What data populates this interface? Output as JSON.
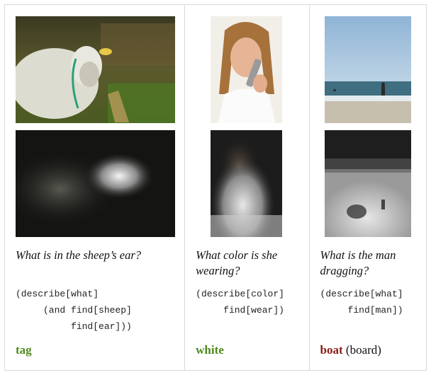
{
  "panels": [
    {
      "question": "What is in the sheep’s ear?",
      "program": "(describe[what]\n     (and find[sheep]\n          find[ear]))",
      "answer": "tag",
      "answer_note": "",
      "answer_color": "#4c8a1a"
    },
    {
      "question": "What color is she wearing?",
      "program": "(describe[color]\n     find[wear])",
      "answer": "white",
      "answer_note": "",
      "answer_color": "#4c8a1a"
    },
    {
      "question": "What is the man dragging?",
      "program": "(describe[what]\n     find[man])",
      "answer": "boat",
      "answer_note": "(board)",
      "answer_color": "#8b1a14"
    }
  ]
}
